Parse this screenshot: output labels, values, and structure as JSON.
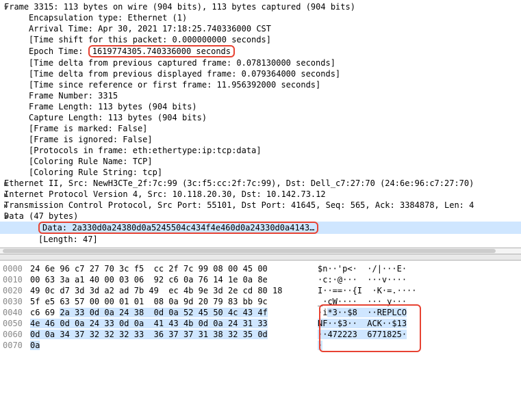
{
  "details": {
    "frame_header": "Frame 3315: 113 bytes on wire (904 bits), 113 bytes captured (904 bits)",
    "encap": "Encapsulation type: Ethernet (1)",
    "arrival": "Arrival Time: Apr 30, 2021 17:18:25.740336000 CST",
    "timeshift": "[Time shift for this packet: 0.000000000 seconds]",
    "epoch_label": "Epoch Time:",
    "epoch_value": "1619774305.740336000 seconds",
    "delta_cap": "[Time delta from previous captured frame: 0.078130000 seconds]",
    "delta_disp": "[Time delta from previous displayed frame: 0.079364000 seconds]",
    "since_ref": "[Time since reference or first frame: 11.956392000 seconds]",
    "frame_num": "Frame Number: 3315",
    "frame_len": "Frame Length: 113 bytes (904 bits)",
    "cap_len": "Capture Length: 113 bytes (904 bits)",
    "marked": "[Frame is marked: False]",
    "ignored": "[Frame is ignored: False]",
    "proto_in": "[Protocols in frame: eth:ethertype:ip:tcp:data]",
    "color_name": "[Coloring Rule Name: TCP]",
    "color_str": "[Coloring Rule String: tcp]",
    "eth": "Ethernet II, Src: NewH3CTe_2f:7c:99 (3c:f5:cc:2f:7c:99), Dst: Dell_c7:27:70 (24:6e:96:c7:27:70)",
    "ip": "Internet Protocol Version 4, Src: 10.118.20.30, Dst: 10.142.73.12",
    "tcp": "Transmission Control Protocol, Src Port: 55101, Dst Port: 41645, Seq: 565, Ack: 3384878, Len: 4",
    "data_hdr": "Data (47 bytes)",
    "data_val": "Data: 2a330d0a24380d0a5245504c434f4e460d0a24330d0a4143…",
    "data_len": "[Length: 47]"
  },
  "hex": {
    "rows": [
      {
        "off": "0000",
        "b": "24 6e 96 c7 27 70 3c f5  cc 2f 7c 99 08 00 45 00",
        "a": "$n··'p<·  ·/|···E·"
      },
      {
        "off": "0010",
        "b": "00 63 3a a1 40 00 03 06  92 c6 0a 76 14 1e 0a 8e",
        "a": "·c:·@···  ···v····"
      },
      {
        "off": "0020",
        "b": "49 0c d7 3d 3d a2 ad 7b 49  ec 4b 9e 3d 2e cd 80 18",
        "a": "I··==··{I  ·K·=.····"
      },
      {
        "off": "0030",
        "b": "5f e5 63 57 00 00 01 01  08 0a 9d 20 79 83 bb 9c",
        "a": "_·cW····  ··· y···"
      },
      {
        "off": "0040",
        "b": "c6 69 ",
        "bs": "2a 33 0d 0a 24 38  0d 0a 52 45 50 4c 43 4f",
        "a": "·i",
        "as": "*3··$8  ··REPLCO"
      },
      {
        "off": "0050",
        "bs": "4e 46 0d 0a 24 33 0d 0a  41 43 4b 0d 0a 24 31 33",
        "as": "NF··$3··  ACK··$13"
      },
      {
        "off": "0060",
        "bs": "0d 0a 34 37 32 32 32 33  36 37 37 31 38 32 35 0d",
        "as": "··472223  6771825·"
      },
      {
        "off": "0070",
        "bs": "0a",
        "as": "·"
      }
    ]
  }
}
